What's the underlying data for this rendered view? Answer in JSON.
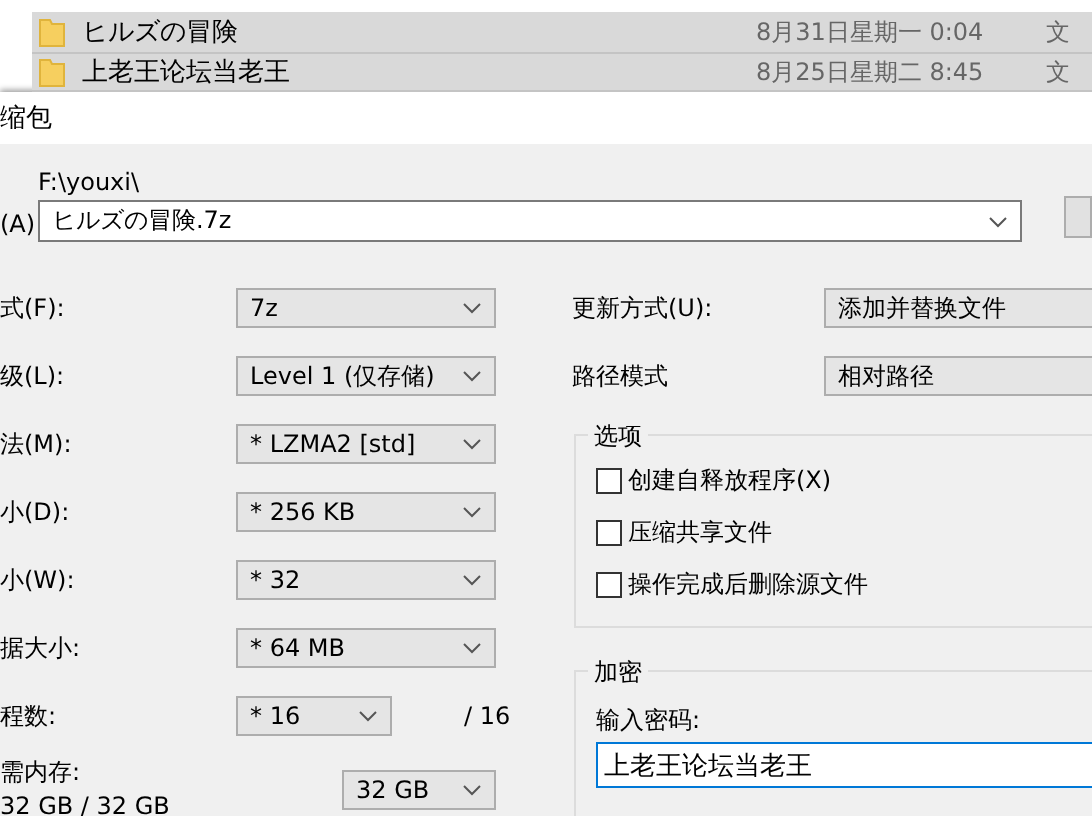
{
  "files": [
    {
      "name": "ヒルズの冒険",
      "date": "8月31日星期一 0:04",
      "type": "文"
    },
    {
      "name": "上老王论坛当老王",
      "date": "8月25日星期二 8:45",
      "type": "文"
    }
  ],
  "dialog": {
    "title": "缩包",
    "archive": {
      "label": "(A)",
      "folder": "F:\\youxi\\",
      "value": "ヒルズの冒険.7z"
    },
    "settings": [
      {
        "label": "式(F):",
        "value": "7z"
      },
      {
        "label": "级(L):",
        "value": "Level 1 (仅存储)"
      },
      {
        "label": "法(M):",
        "value": "* LZMA2 [std]"
      },
      {
        "label": "小(D):",
        "value": "* 256 KB"
      },
      {
        "label": "小(W):",
        "value": "* 32"
      },
      {
        "label": "据大小:",
        "value": "* 64 MB"
      }
    ],
    "threads": {
      "label": "程数:",
      "value": "* 16",
      "max": "/ 16"
    },
    "memory": {
      "label": "需内存:",
      "reading": "32 GB / 32 GB",
      "value": "32 GB"
    },
    "modes": [
      {
        "label": "更新方式(U):",
        "value": "添加并替换文件"
      },
      {
        "label": "路径模式",
        "value": "相对路径"
      }
    ],
    "options": {
      "title": "选项",
      "items": [
        {
          "label": "创建自释放程序(X)",
          "checked": false
        },
        {
          "label": "压缩共享文件",
          "checked": false
        },
        {
          "label": "操作完成后删除源文件",
          "checked": false
        }
      ]
    },
    "encryption": {
      "title": "加密",
      "password_label": "输入密码:",
      "password": "上老王论坛当老王"
    }
  }
}
